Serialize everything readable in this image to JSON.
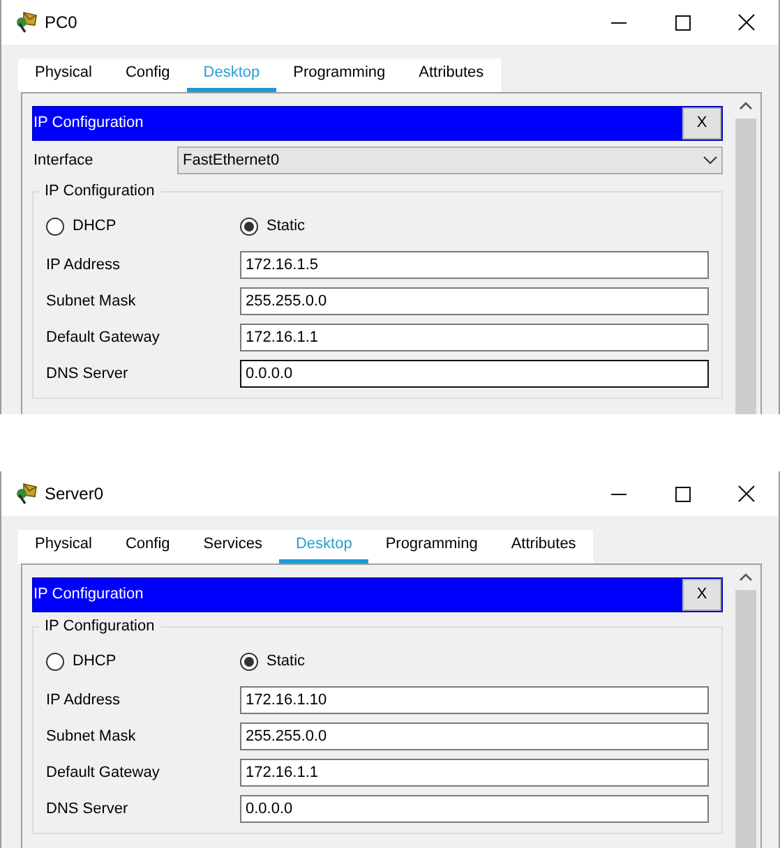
{
  "windows": [
    {
      "title": "PC0",
      "tabs": [
        {
          "label": "Physical",
          "selected": false
        },
        {
          "label": "Config",
          "selected": false
        },
        {
          "label": "Desktop",
          "selected": true
        },
        {
          "label": "Programming",
          "selected": false
        },
        {
          "label": "Attributes",
          "selected": false
        }
      ],
      "panel": {
        "title": "IP Configuration",
        "close": "X",
        "interface": {
          "label": "Interface",
          "value": "FastEthernet0"
        },
        "group": "IP Configuration",
        "modes": [
          {
            "label": "DHCP",
            "selected": false
          },
          {
            "label": "Static",
            "selected": true
          }
        ],
        "fields": [
          {
            "label": "IP Address",
            "value": "172.16.1.5",
            "focused": false
          },
          {
            "label": "Subnet Mask",
            "value": "255.255.0.0",
            "focused": false
          },
          {
            "label": "Default Gateway",
            "value": "172.16.1.1",
            "focused": false
          },
          {
            "label": "DNS Server",
            "value": "0.0.0.0",
            "focused": true
          }
        ]
      }
    },
    {
      "title": "Server0",
      "tabs": [
        {
          "label": "Physical",
          "selected": false
        },
        {
          "label": "Config",
          "selected": false
        },
        {
          "label": "Services",
          "selected": false
        },
        {
          "label": "Desktop",
          "selected": true
        },
        {
          "label": "Programming",
          "selected": false
        },
        {
          "label": "Attributes",
          "selected": false
        }
      ],
      "panel": {
        "title": "IP Configuration",
        "close": "X",
        "group": "IP Configuration",
        "modes": [
          {
            "label": "DHCP",
            "selected": false
          },
          {
            "label": "Static",
            "selected": true
          }
        ],
        "fields": [
          {
            "label": "IP Address",
            "value": "172.16.1.10",
            "focused": false
          },
          {
            "label": "Subnet Mask",
            "value": "255.255.0.0",
            "focused": false
          },
          {
            "label": "Default Gateway",
            "value": "172.16.1.1",
            "focused": false
          },
          {
            "label": "DNS Server",
            "value": "0.0.0.0",
            "focused": false
          }
        ]
      }
    }
  ]
}
